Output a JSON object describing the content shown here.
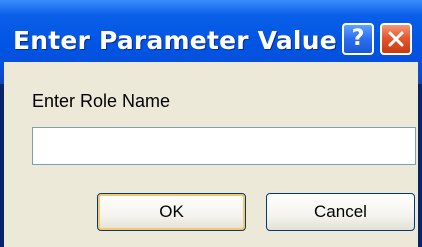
{
  "window": {
    "title": "Enter Parameter Value",
    "help_glyph": "?",
    "help_icon": "help-icon",
    "close_icon": "close-icon",
    "title_color": "#0054e3",
    "close_color": "#e5582e"
  },
  "dialog": {
    "prompt": "Enter Role Name",
    "input_value": "",
    "ok_label": "OK",
    "cancel_label": "Cancel"
  }
}
